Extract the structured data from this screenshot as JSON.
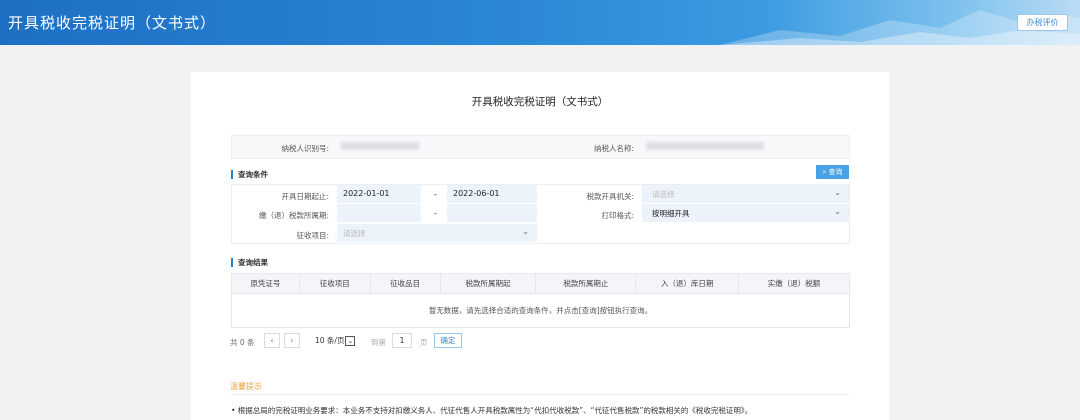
{
  "header": {
    "title": "开具税收完税证明（文书式）",
    "eval_button": "办税评价"
  },
  "page": {
    "title": "开具税收完税证明（文书式）"
  },
  "taxpayer": {
    "id_label": "纳税人识别号:",
    "name_label": "纳税人名称:"
  },
  "query": {
    "section_title": "查询条件",
    "search_button": "查询",
    "issue_date_label": "开具日期起止:",
    "issue_date_from": "2022-01-01",
    "issue_date_to": "2022-06-01",
    "range_sep": "-",
    "tax_office_label": "税款开具机关:",
    "tax_office_placeholder": "请选择",
    "period_label": "缴（退）税款所属期:",
    "period_sep": "-",
    "print_format_label": "打印格式:",
    "print_format_value": "按明细开具",
    "collection_item_label": "征收项目:",
    "collection_item_placeholder": "请选择"
  },
  "results": {
    "section_title": "查询结果",
    "columns": [
      "原凭证号",
      "征收项目",
      "征收品目",
      "税款所属期起",
      "税款所属期止",
      "入（退）库日期",
      "实缴（退）税额"
    ],
    "empty_text": "暂无数据，请先选择合适的查询条件，并点击[查询]按钮执行查询。"
  },
  "pagination": {
    "total": "共 0 条",
    "prev": "‹",
    "next": "›",
    "page_size": "10 条/页",
    "goto_label": "到第",
    "goto_value": "1",
    "page_unit": "页",
    "confirm": "确定"
  },
  "tips": {
    "title": "温馨提示",
    "text": "• 根据总局的完税证明业务要求：本业务不支持对扣缴义务人、代征代售人开具税款属性为“代扣代收税款”、“代征代售税款”的税款相关的《税收完税证明》。"
  },
  "colors": {
    "brand": "#1e6fc3",
    "accent": "#47a3e6",
    "tips": "#e8a43c"
  }
}
